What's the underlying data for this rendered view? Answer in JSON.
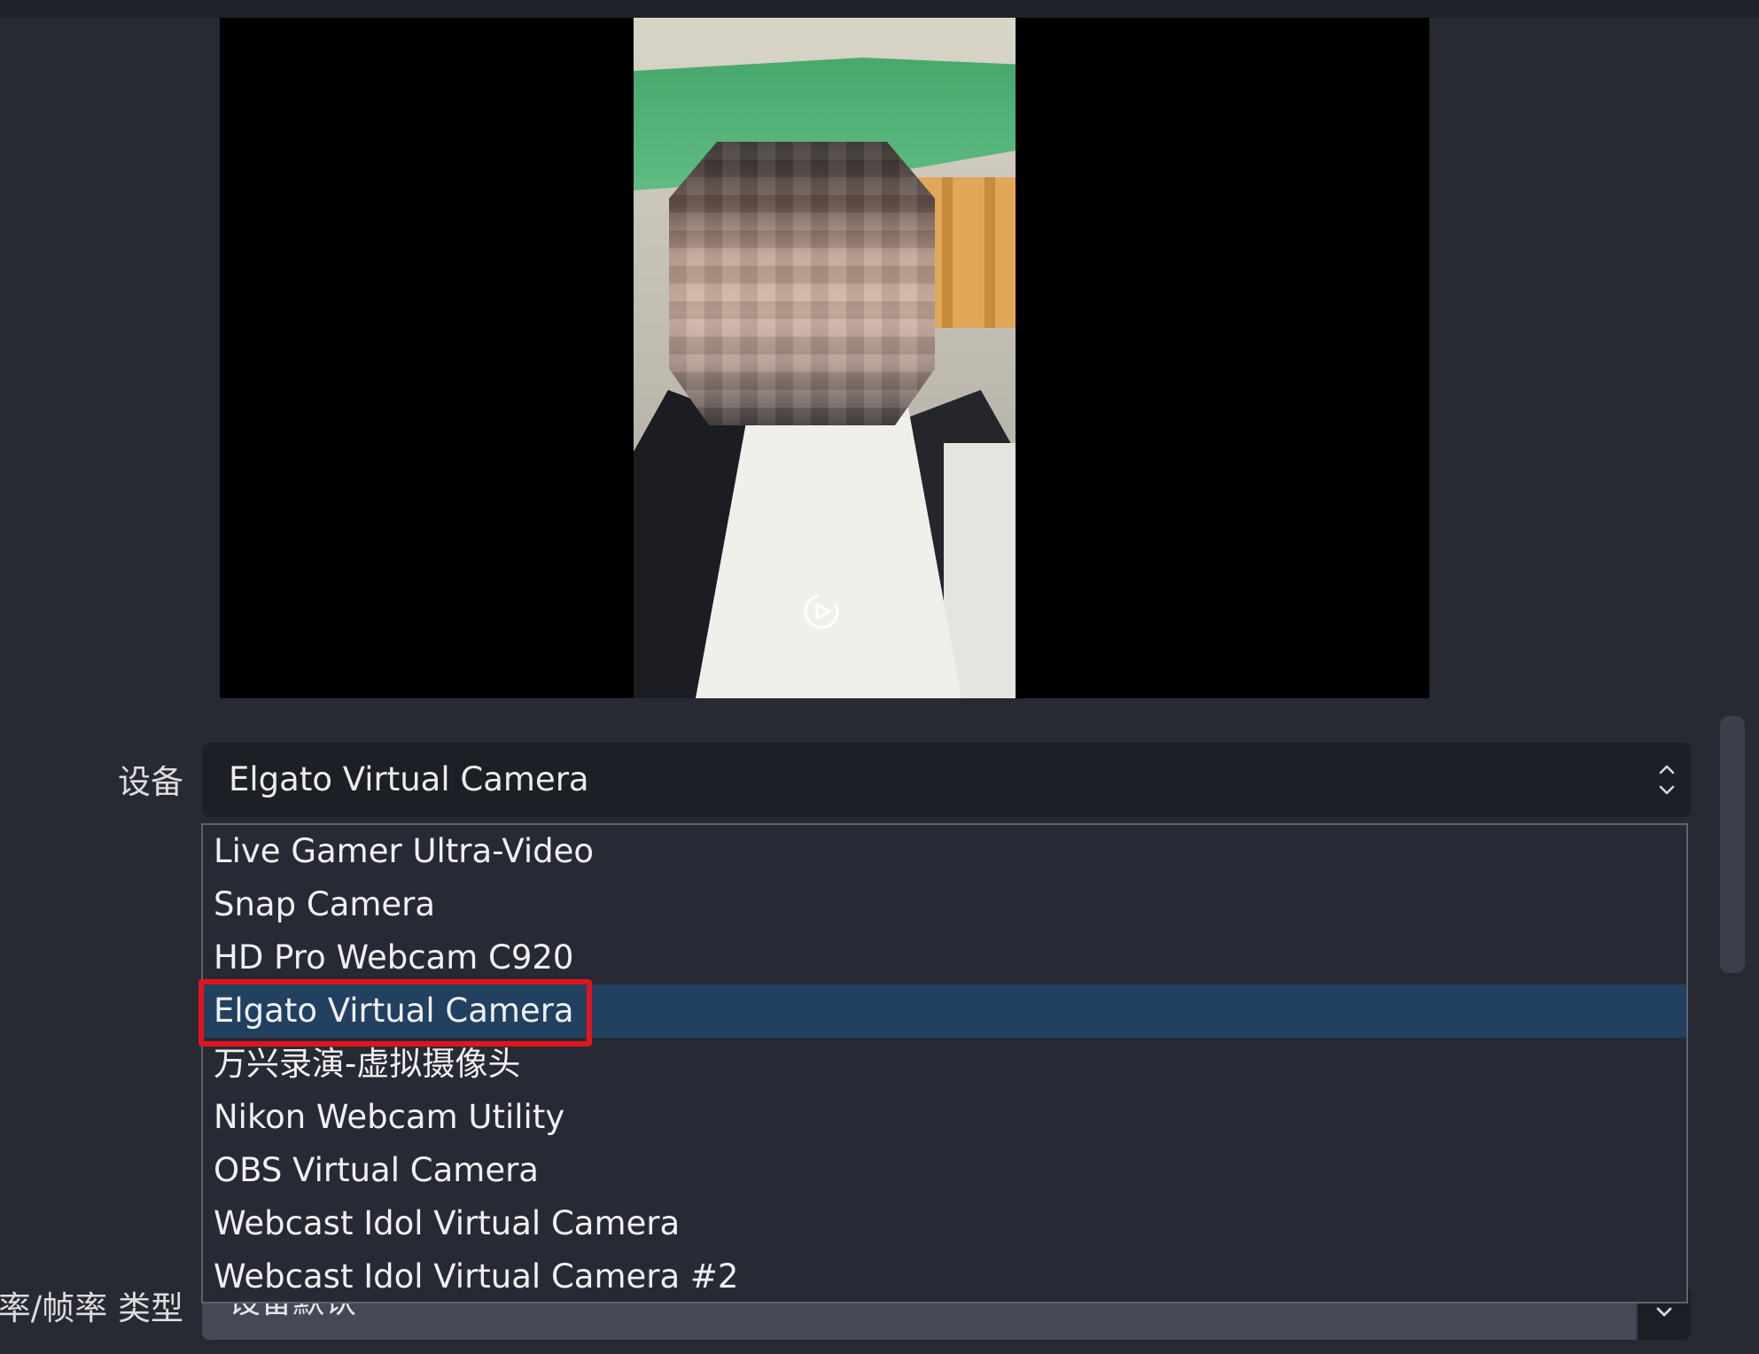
{
  "form": {
    "device_label": "设备",
    "device_value": "Elgato Virtual Camera",
    "resolution_label": "率/帧率 类型",
    "resolution_value": "设备默认"
  },
  "dropdown": {
    "items": [
      {
        "label": "Live Gamer Ultra-Video",
        "selected": false
      },
      {
        "label": "Snap Camera",
        "selected": false
      },
      {
        "label": "HD Pro Webcam C920",
        "selected": false
      },
      {
        "label": "Elgato Virtual Camera",
        "selected": true
      },
      {
        "label": "万兴录演-虚拟摄像头",
        "selected": false
      },
      {
        "label": "Nikon Webcam Utility",
        "selected": false
      },
      {
        "label": "OBS Virtual Camera",
        "selected": false
      },
      {
        "label": "Webcast Idol Virtual Camera",
        "selected": false
      },
      {
        "label": "Webcast Idol Virtual Camera #2",
        "selected": false
      }
    ]
  },
  "icons": {
    "spinner": "up-down-chevron-icon",
    "dropdown_arrow": "chevron-down-icon",
    "watermark": "elgato-logo-icon"
  },
  "colors": {
    "background": "#272a33",
    "selected_item": "#22405f",
    "highlight_border": "#e0141e"
  }
}
